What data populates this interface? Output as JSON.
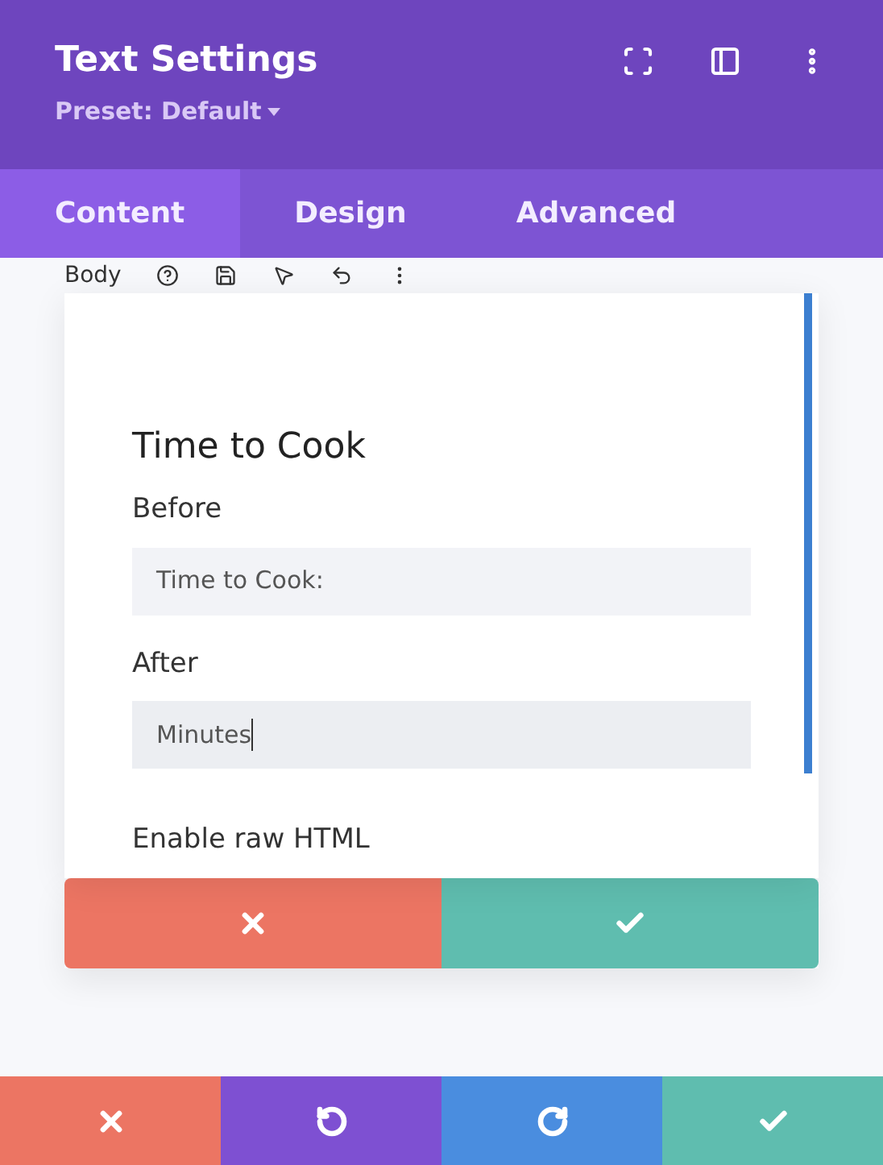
{
  "header": {
    "title": "Text Settings",
    "preset": "Preset: Default"
  },
  "tabs": [
    {
      "label": "Content",
      "selected": true
    },
    {
      "label": "Design",
      "selected": false
    },
    {
      "label": "Advanced",
      "selected": false
    }
  ],
  "toolbar": {
    "label": "Body"
  },
  "card": {
    "heading": "Time to Cook",
    "fields": [
      {
        "label": "Before",
        "value": "Time to Cook:",
        "focused": false
      },
      {
        "label": "After",
        "value": "Minutes",
        "focused": true
      }
    ],
    "option_label": "Enable raw HTML",
    "actions": [
      {
        "kind": "cancel"
      },
      {
        "kind": "confirm"
      }
    ]
  },
  "footer": [
    {
      "kind": "cancel"
    },
    {
      "kind": "undo"
    },
    {
      "kind": "redo"
    },
    {
      "kind": "confirm"
    }
  ]
}
